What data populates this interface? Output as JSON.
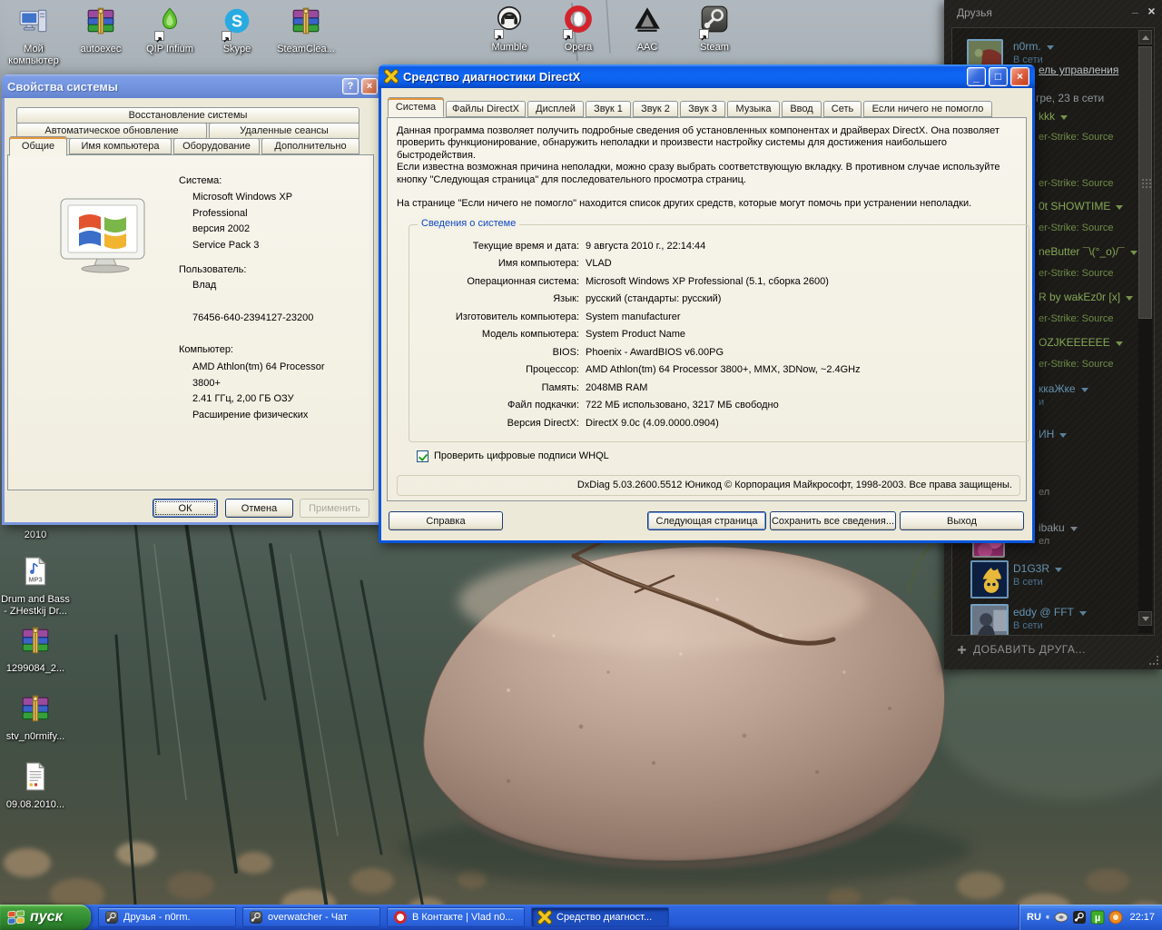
{
  "colors": {
    "xp_titlebar_blue": "#0b5ce6",
    "xp_dialog_face": "#ece9d8",
    "taskbar_blue": "#2a60dc",
    "start_button_green": "#359235",
    "steam_panel_bg": "#1b1a17",
    "steam_ingame_green": "#86a855",
    "steam_online_blue": "#6593b1",
    "tab_active_accent_orange": "#e5953a"
  },
  "desktop": {
    "icons": [
      {
        "label": "Мой компьютер",
        "icon": "my-computer-icon"
      },
      {
        "label": "autoexec",
        "icon": "winrar-icon"
      },
      {
        "label": "QIP Infium",
        "icon": "qip-icon"
      },
      {
        "label": "Skype",
        "icon": "skype-icon"
      },
      {
        "label": "SteamClea...",
        "icon": "winrar-icon"
      },
      {
        "label": "Mumble",
        "icon": "mumble-icon"
      },
      {
        "label": "Opera",
        "icon": "opera-icon"
      },
      {
        "label": "AAC",
        "icon": "aac-icon"
      },
      {
        "label": "Steam",
        "icon": "steam-icon"
      },
      {
        "label": "2010",
        "icon": "hidden"
      },
      {
        "label": "Drum and Bass - ZHestkij Dr...",
        "icon": "mp3-file-icon"
      },
      {
        "label": "1299084_2...",
        "icon": "winrar-icon"
      },
      {
        "label": "stv_n0rmify...",
        "icon": "winrar-icon"
      },
      {
        "label": "09.08.2010...",
        "icon": "log-file-icon"
      }
    ]
  },
  "sysprops": {
    "title": "Свойства системы",
    "titlebar": {
      "help_glyph": "?",
      "close_glyph": "×"
    },
    "tabs_row1": [
      "Восстановление системы"
    ],
    "tabs_row2": [
      "Автоматическое обновление",
      "Удаленные сеансы"
    ],
    "tabs_row3": [
      "Общие",
      "Имя компьютера",
      "Оборудование",
      "Дополнительно"
    ],
    "active_tab": "Общие",
    "system_label": "Система:",
    "system_lines": [
      "Microsoft Windows XP",
      "Professional",
      "версия 2002",
      "Service Pack 3"
    ],
    "user_label": "Пользователь:",
    "user_name": "Влад",
    "serial": "76456-640-2394127-23200",
    "computer_label": "Компьютер:",
    "computer_lines": [
      "AMD Athlon(tm) 64 Processor",
      "3800+",
      "2.41 ГГц, 2,00 ГБ ОЗУ",
      "Расширение физических"
    ],
    "buttons": {
      "ok": "ОК",
      "cancel": "Отмена",
      "apply": "Применить"
    }
  },
  "dxdiag": {
    "title": "Средство диагностики DirectX",
    "titlebar": {
      "minimize_glyph": "_",
      "maximize_glyph": "□",
      "close_glyph": "×"
    },
    "tabs": [
      "Система",
      "Файлы DirectX",
      "Дисплей",
      "Звук 1",
      "Звук 2",
      "Звук 3",
      "Музыка",
      "Ввод",
      "Сеть",
      "Если ничего не помогло"
    ],
    "active_tab": "Система",
    "intro": {
      "p1": "Данная программа позволяет получить подробные сведения об установленных компонентах и драйверах DirectX. Она позволяет проверить функционирование, обнаружить неполадки и произвести настройку системы для достижения наибольшего быстродействия.",
      "p2": "Если известна возможная причина неполадки, можно сразу выбрать соответствующую вкладку. В противном случае используйте кнопку \"Следующая страница\" для последовательного просмотра страниц.",
      "p3": "На странице \"Если ничего не помогло\" находится список других средств, которые могут помочь при устранении неполадки."
    },
    "group_title": "Сведения о системе",
    "info_rows": [
      {
        "label": "Текущие время и дата:",
        "value": "9 августа 2010 г., 22:14:44"
      },
      {
        "label": "Имя компьютера:",
        "value": "VLAD"
      },
      {
        "label": "Операционная система:",
        "value": "Microsoft Windows XP Professional (5.1, сборка 2600)"
      },
      {
        "label": "Язык:",
        "value": "русский (стандарты: русский)"
      },
      {
        "label": "Изготовитель компьютера:",
        "value": "System manufacturer"
      },
      {
        "label": "Модель компьютера:",
        "value": "System Product Name"
      },
      {
        "label": "BIOS:",
        "value": "Phoenix - AwardBIOS v6.00PG"
      },
      {
        "label": "Процессор:",
        "value": "AMD Athlon(tm) 64 Processor 3800+,  MMX,  3DNow, ~2.4GHz"
      },
      {
        "label": "Память:",
        "value": "2048MB RAM"
      },
      {
        "label": "Файл подкачки:",
        "value": "722 МБ использовано, 3217 МБ свободно"
      },
      {
        "label": "Версия DirectX:",
        "value": "DirectX 9.0c (4.09.0000.0904)"
      }
    ],
    "whql_label": "Проверить цифровые подписи WHQL",
    "whql_checked": true,
    "copyright": "DxDiag 5.03.2600.5512 Юникод  © Корпорация Майкрософт, 1998-2003.  Все права защищены.",
    "buttons": {
      "help": "Справка",
      "next": "Следующая страница",
      "save": "Сохранить все сведения...",
      "exit": "Выход"
    }
  },
  "friends": {
    "title": "Друзья",
    "titlebar": {
      "minimize_glyph": "_",
      "close_glyph": "×"
    },
    "self": {
      "name": "n0rm.",
      "status": "В сети"
    },
    "link_fragment": "ель управления",
    "online_fragment": "гре, 23 в сети",
    "items": [
      {
        "name": "kkk",
        "status": "er-Strike: Source",
        "kind": "ingame"
      },
      {
        "name": "",
        "status": "er-Strike: Source",
        "kind": "ingame"
      },
      {
        "name": "0t SHOWTIME",
        "status": "er-Strike: Source",
        "kind": "ingame"
      },
      {
        "name": "neButter ¯\\(°_o)/¯",
        "status": "er-Strike: Source",
        "kind": "ingame"
      },
      {
        "name": "R by wakEz0r [x]",
        "status": "er-Strike: Source",
        "kind": "ingame"
      },
      {
        "name": "OZJKEEEEEE",
        "status": "er-Strike: Source",
        "kind": "ingame"
      },
      {
        "name": "ккаЖке",
        "status": "и",
        "kind": "online"
      },
      {
        "name": "ИН",
        "status": "",
        "kind": "online"
      },
      {
        "name": "",
        "status": "ел",
        "kind": "away"
      },
      {
        "name": "ibaku",
        "status": "ел",
        "kind": "away"
      },
      {
        "name": "D1G3R",
        "status": "В сети",
        "kind": "online"
      },
      {
        "name": "eddy @ FFT",
        "status": "В сети",
        "kind": "online"
      }
    ],
    "add_friend": "ДОБАВИТЬ ДРУГА..."
  },
  "taskbar": {
    "start_label": "пуск",
    "tasks": [
      {
        "label": "Друзья - n0rm.",
        "icon": "steam-task-icon",
        "active": false
      },
      {
        "label": "overwatcher - Чат",
        "icon": "steam-task-icon",
        "active": false
      },
      {
        "label": "В Контакте | Vlad n0...",
        "icon": "opera-task-icon",
        "active": false
      },
      {
        "label": "Средство диагност...",
        "icon": "dxdiag-task-icon",
        "active": true
      }
    ],
    "tray": {
      "language": "RU",
      "icons": [
        "mumble-tray-icon",
        "steam-tray-icon",
        "utorrent-tray-icon",
        "qip-tray-icon"
      ],
      "clock": "22:17"
    }
  }
}
